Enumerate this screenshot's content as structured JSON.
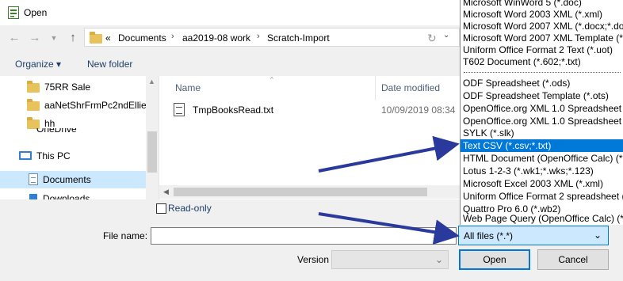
{
  "window": {
    "title": "Open"
  },
  "address": {
    "overflow": "«",
    "crumbs": [
      "Documents",
      "aa2019-08 work",
      "Scratch-Import"
    ],
    "separator": "›"
  },
  "toolbar": {
    "organize_label": "Organize ▾",
    "new_folder_label": "New folder"
  },
  "navpane": {
    "items": [
      {
        "label": "75RR Sale",
        "icon": "folder-icon"
      },
      {
        "label": "aaNetShrFrmPc2ndEllie",
        "icon": "folder-icon"
      },
      {
        "label": "hh",
        "icon": "folder-icon"
      },
      {
        "label": "OneDrive",
        "icon": "cloud-icon"
      },
      {
        "label": "This PC",
        "icon": "computer-icon"
      },
      {
        "label": "Documents",
        "icon": "documents-icon",
        "selected": true
      },
      {
        "label": "Downloads",
        "icon": "downloads-icon"
      }
    ]
  },
  "filelist": {
    "columns": [
      "Name",
      "Date modified"
    ],
    "files": [
      {
        "name": "TmpBooksRead.txt",
        "date": "10/09/2019 08:34"
      }
    ]
  },
  "readonly": {
    "label": "Read-only"
  },
  "filename": {
    "label": "File name:",
    "value": ""
  },
  "filter": {
    "selected": "All files (*.*)"
  },
  "version": {
    "label": "Version",
    "value": ""
  },
  "buttons": {
    "open": "Open",
    "cancel": "Cancel"
  },
  "filetype_options": [
    "Microsoft WinWord 5 (*.doc)",
    "Microsoft Word 2003 XML (*.xml)",
    "Microsoft Word 2007 XML (*.docx;*.do",
    "Microsoft Word 2007 XML Template (*.",
    "Uniform Office Format 2 Text (*.uot)",
    "T602 Document (*.602;*.txt)",
    "ODF Spreadsheet (*.ods)",
    "ODF Spreadsheet Template (*.ots)",
    "OpenOffice.org XML 1.0 Spreadsheet (*",
    "OpenOffice.org XML 1.0 Spreadsheet T",
    "SYLK (*.slk)",
    "Text CSV (*.csv;*.txt)",
    "HTML Document (OpenOffice Calc) (*.h",
    "Lotus 1-2-3 (*.wk1;*.wks;*.123)",
    "Microsoft Excel 2003 XML (*.xml)",
    "Uniform Office Format 2 spreadsheet (",
    "Quattro Pro 6.0 (*.wb2)",
    "Web Page Query (OpenOffice Calc) (*.h"
  ],
  "selected_option": "Text CSV (*.csv;*.txt)",
  "colors": {
    "accent": "#0078d7",
    "selection": "#cce8ff",
    "arrow": "#2a3a9c",
    "folder": "#e8c25a"
  }
}
